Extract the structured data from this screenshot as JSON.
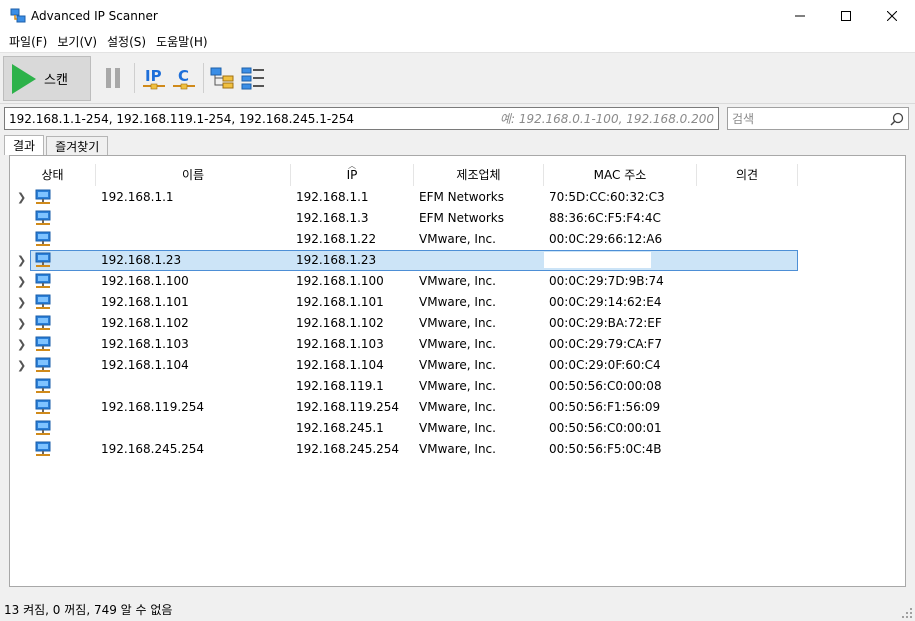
{
  "window": {
    "title": "Advanced IP Scanner"
  },
  "menu": [
    {
      "label": "파일(F)"
    },
    {
      "label": "보기(V)"
    },
    {
      "label": "설정(S)"
    },
    {
      "label": "도움말(H)"
    }
  ],
  "toolbar": {
    "scan_label": "스캔",
    "ip_label": "IP",
    "c_label": "C"
  },
  "range": {
    "value": "192.168.1.1-254, 192.168.119.1-254, 192.168.245.1-254",
    "placeholder": "예: 192.168.0.1-100, 192.168.0.200"
  },
  "search": {
    "placeholder": "검색"
  },
  "tabs": [
    {
      "label": "결과"
    },
    {
      "label": "즐겨찾기"
    }
  ],
  "columns": {
    "status": "상태",
    "name": "이름",
    "ip": "IP",
    "vendor": "제조업체",
    "mac": "MAC 주소",
    "comment": "의견"
  },
  "rows": [
    {
      "name": "192.168.1.1",
      "ip": "192.168.1.1",
      "vendor": "EFM Networks",
      "mac": "70:5D:CC:60:32:C3",
      "expand": true
    },
    {
      "name": "",
      "ip": "192.168.1.3",
      "vendor": "EFM Networks",
      "mac": "88:36:6C:F5:F4:4C",
      "expand": false
    },
    {
      "name": "",
      "ip": "192.168.1.22",
      "vendor": "VMware, Inc.",
      "mac": "00:0C:29:66:12:A6",
      "expand": false
    },
    {
      "name": "192.168.1.23",
      "ip": "192.168.1.23",
      "vendor": "",
      "mac": "",
      "expand": true,
      "selected": true
    },
    {
      "name": "192.168.1.100",
      "ip": "192.168.1.100",
      "vendor": "VMware, Inc.",
      "mac": "00:0C:29:7D:9B:74",
      "expand": true
    },
    {
      "name": "192.168.1.101",
      "ip": "192.168.1.101",
      "vendor": "VMware, Inc.",
      "mac": "00:0C:29:14:62:E4",
      "expand": true
    },
    {
      "name": "192.168.1.102",
      "ip": "192.168.1.102",
      "vendor": "VMware, Inc.",
      "mac": "00:0C:29:BA:72:EF",
      "expand": true
    },
    {
      "name": "192.168.1.103",
      "ip": "192.168.1.103",
      "vendor": "VMware, Inc.",
      "mac": "00:0C:29:79:CA:F7",
      "expand": true
    },
    {
      "name": "192.168.1.104",
      "ip": "192.168.1.104",
      "vendor": "VMware, Inc.",
      "mac": "00:0C:29:0F:60:C4",
      "expand": true
    },
    {
      "name": "",
      "ip": "192.168.119.1",
      "vendor": "VMware, Inc.",
      "mac": "00:50:56:C0:00:08",
      "expand": false
    },
    {
      "name": "192.168.119.254",
      "ip": "192.168.119.254",
      "vendor": "VMware, Inc.",
      "mac": "00:50:56:F1:56:09",
      "expand": false
    },
    {
      "name": "",
      "ip": "192.168.245.1",
      "vendor": "VMware, Inc.",
      "mac": "00:50:56:C0:00:01",
      "expand": false
    },
    {
      "name": "192.168.245.254",
      "ip": "192.168.245.254",
      "vendor": "VMware, Inc.",
      "mac": "00:50:56:F5:0C:4B",
      "expand": false
    }
  ],
  "status": {
    "text": "13 켜짐, 0 꺼짐, 749 알 수 없음"
  },
  "colors": {
    "selected_bg": "#cce4f7",
    "selected_border": "#4d8fd6",
    "scan_green": "#2db24a",
    "icon_blue": "#1e6fd9"
  }
}
